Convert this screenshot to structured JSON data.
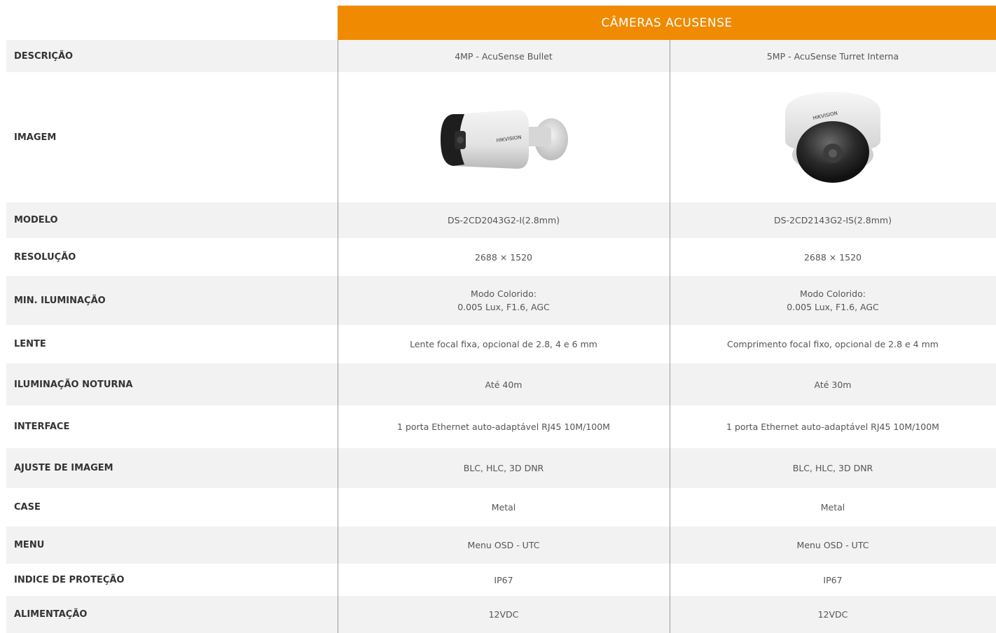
{
  "header": {
    "title": "CÂMERAS ACUSENSE"
  },
  "rows": [
    {
      "label": "DESCRIÇÃO",
      "v1": "4MP - AcuSense Bullet",
      "v2": "5MP - AcuSense Turret Interna"
    },
    {
      "label": "IMAGEM",
      "v1": "bullet-camera-image",
      "v2": "dome-camera-image",
      "v1_logo": "HIKVISION",
      "v2_logo": "HIKVISION"
    },
    {
      "label": "MODELO",
      "v1": "DS-2CD2043G2-I(2.8mm)",
      "v2": "DS-2CD2143G2-IS(2.8mm)"
    },
    {
      "label": "RESOLUÇÃO",
      "v1": "2688 × 1520",
      "v2": "2688 × 1520"
    },
    {
      "label": "MIN. ILUMINAÇÃO",
      "v1_line1": "Modo Colorido:",
      "v1_line2": "0.005 Lux, F1.6, AGC",
      "v2_line1": "Modo Colorido:",
      "v2_line2": "0.005 Lux, F1.6, AGC"
    },
    {
      "label": "LENTE",
      "v1": "Lente focal fixa, opcional de 2.8, 4 e 6 mm",
      "v2": "Comprimento focal fixo, opcional de 2.8 e 4 mm"
    },
    {
      "label": "ILUMINAÇÃO NOTURNA",
      "v1": "Até 40m",
      "v2": "Até 30m"
    },
    {
      "label": "INTERFACE",
      "v1": "1 porta Ethernet auto-adaptável RJ45 10M/100M",
      "v2": "1 porta Ethernet auto-adaptável RJ45 10M/100M"
    },
    {
      "label": "AJUSTE DE IMAGEM",
      "v1": "BLC, HLC, 3D DNR",
      "v2": "BLC, HLC, 3D DNR"
    },
    {
      "label": "CASE",
      "v1": "Metal",
      "v2": "Metal"
    },
    {
      "label": "MENU",
      "v1": "Menu OSD - UTC",
      "v2": "Menu OSD - UTC"
    },
    {
      "label": "INDICE DE PROTEÇÃO",
      "v1": "IP67",
      "v2": "IP67"
    },
    {
      "label": "ALIMENTAÇÃO",
      "v1": "12VDC",
      "v2": "12VDC"
    }
  ],
  "colors": {
    "accent": "#f08a00",
    "row_shade": "#f2f2f2",
    "divider": "#9a9a9a"
  }
}
